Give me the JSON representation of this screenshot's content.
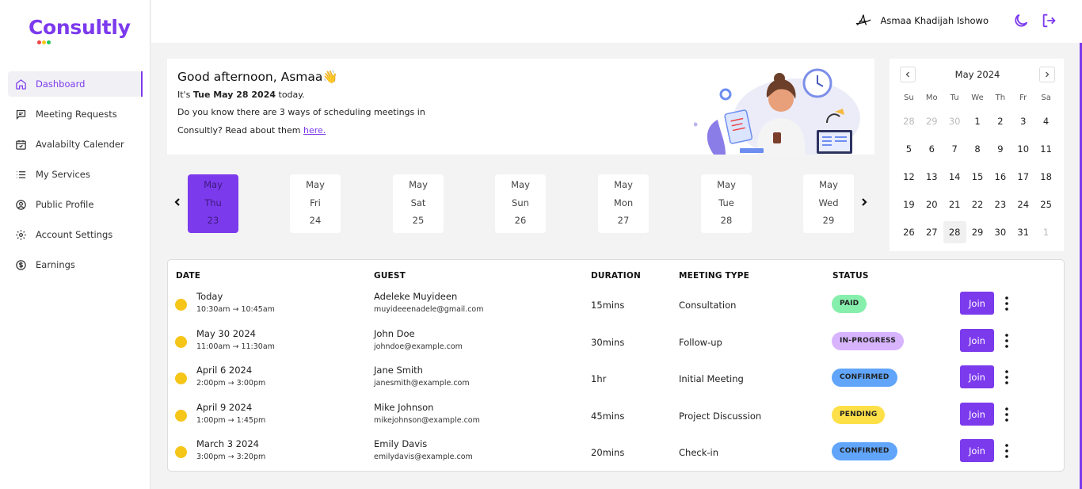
{
  "app": {
    "name": "Consultly",
    "logo_dot_colors": [
      "#ef4444",
      "#f5c518",
      "#22c55e"
    ],
    "accent": "#7c3aed"
  },
  "sidebar": {
    "items": [
      {
        "label": "Dashboard",
        "icon": "home-icon",
        "active": true
      },
      {
        "label": "Meeting Requests",
        "icon": "chat-icon"
      },
      {
        "label": "Avalabilty Calender",
        "icon": "calendar-check-icon"
      },
      {
        "label": "My Services",
        "icon": "list-icon"
      },
      {
        "label": "Public Profile",
        "icon": "user-circle-icon"
      },
      {
        "label": "Account Settings",
        "icon": "gear-icon"
      },
      {
        "label": "Earnings",
        "icon": "dollar-circle-icon"
      }
    ]
  },
  "header": {
    "user_name": "Asmaa Khadijah Ishowo",
    "icons": [
      "avatar-signature-icon",
      "moon-icon",
      "logout-icon"
    ]
  },
  "welcome": {
    "greeting": "Good afternoon, Asmaa👋",
    "date_prefix": "It's ",
    "date": "Tue May 28 2024",
    "date_suffix": " today.",
    "info_line1": "Do you know there are 3 ways of scheduling meetings in",
    "info_line2": "Consultly? Read about them ",
    "link": "here."
  },
  "date_strip": {
    "days": [
      {
        "month": "May",
        "dow": "Thu",
        "day": "23",
        "active": true
      },
      {
        "month": "May",
        "dow": "Fri",
        "day": "24"
      },
      {
        "month": "May",
        "dow": "Sat",
        "day": "25"
      },
      {
        "month": "May",
        "dow": "Sun",
        "day": "26"
      },
      {
        "month": "May",
        "dow": "Mon",
        "day": "27"
      },
      {
        "month": "May",
        "dow": "Tue",
        "day": "28"
      },
      {
        "month": "May",
        "dow": "Wed",
        "day": "29"
      }
    ]
  },
  "calendar": {
    "title": "May 2024",
    "dows": [
      "Su",
      "Mo",
      "Tu",
      "We",
      "Th",
      "Fr",
      "Sa"
    ],
    "weeks": [
      [
        "28",
        "29",
        "30",
        "1",
        "2",
        "3",
        "4"
      ],
      [
        "5",
        "6",
        "7",
        "8",
        "9",
        "10",
        "11"
      ],
      [
        "12",
        "13",
        "14",
        "15",
        "16",
        "17",
        "18"
      ],
      [
        "19",
        "20",
        "21",
        "22",
        "23",
        "24",
        "25"
      ],
      [
        "26",
        "27",
        "28",
        "29",
        "30",
        "31",
        "1"
      ]
    ],
    "muted": [
      [
        0,
        0
      ],
      [
        0,
        1
      ],
      [
        0,
        2
      ],
      [
        4,
        6
      ]
    ],
    "today": [
      4,
      2
    ]
  },
  "table": {
    "headers": {
      "date": "DATE",
      "guest": "GUEST",
      "duration": "DURATION",
      "type": "MEETING TYPE",
      "status": "STATUS"
    },
    "join_label": "Join",
    "rows": [
      {
        "date": "Today",
        "time": "10:30am → 10:45am",
        "guest": "Adeleke Muyideen",
        "email": "muyideeenadele@gmail.com",
        "duration": "15mins",
        "type": "Consultation",
        "status": "PAID",
        "status_color": "#86efac"
      },
      {
        "date": "May 30 2024",
        "time": "11:00am → 11:30am",
        "guest": "John Doe",
        "email": "johndoe@example.com",
        "duration": "30mins",
        "type": "Follow-up",
        "status": "IN-PROGRESS",
        "status_color": "#d8b4fe"
      },
      {
        "date": "April 6 2024",
        "time": "2:00pm → 3:00pm",
        "guest": "Jane Smith",
        "email": "janesmith@example.com",
        "duration": "1hr",
        "type": "Initial Meeting",
        "status": "CONFIRMED",
        "status_color": "#60a5fa"
      },
      {
        "date": "April 9 2024",
        "time": "1:00pm → 1:45pm",
        "guest": "Mike Johnson",
        "email": "mikejohnson@example.com",
        "duration": "45mins",
        "type": "Project Discussion",
        "status": "PENDING",
        "status_color": "#fde047"
      },
      {
        "date": "March 3 2024",
        "time": "3:00pm → 3:20pm",
        "guest": "Emily Davis",
        "email": "emilydavis@example.com",
        "duration": "20mins",
        "type": "Check-in",
        "status": "CONFIRMED",
        "status_color": "#60a5fa"
      }
    ]
  }
}
